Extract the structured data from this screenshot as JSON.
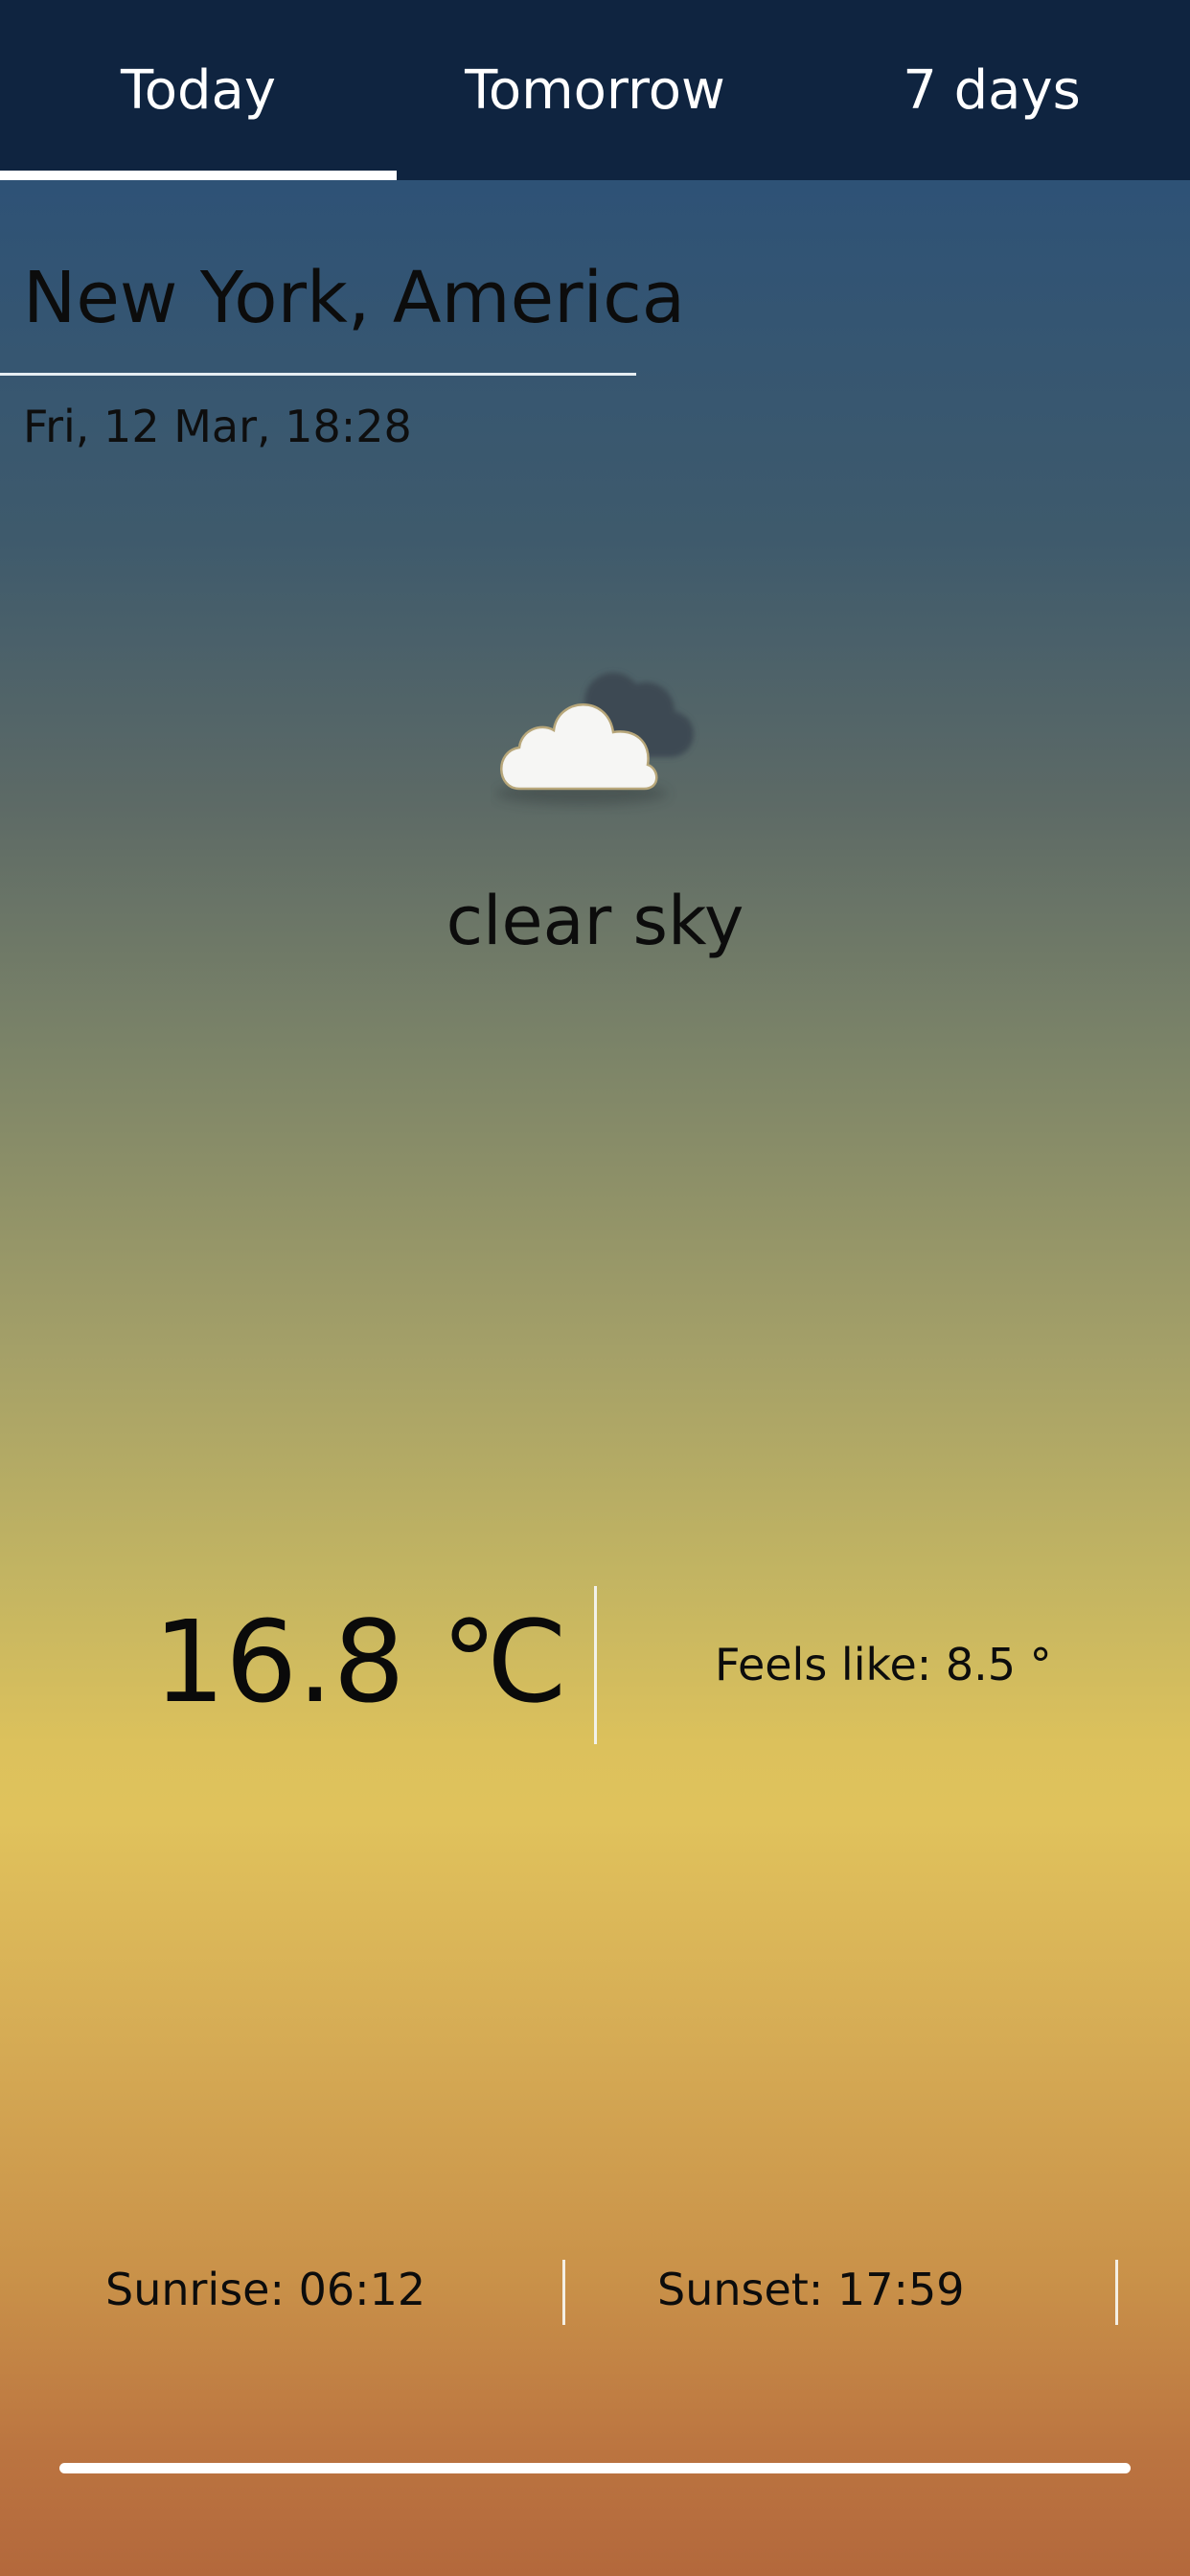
{
  "tabs": [
    {
      "label": "Today",
      "active": true
    },
    {
      "label": "Tomorrow",
      "active": false
    },
    {
      "label": "7 days",
      "active": false
    }
  ],
  "location": "New York, America",
  "datetime": "Fri, 12 Mar, 18:28",
  "weather": {
    "icon": "cloud-icon",
    "condition": "clear sky",
    "temperature": "16.8 ℃",
    "feels_like": "Feels like: 8.5 °"
  },
  "sun": {
    "sunrise": "Sunrise: 06:12",
    "sunset": "Sunset: 17:59"
  },
  "colors": {
    "tabbar": "#0f2440",
    "gradient_top": "#2b5078",
    "gradient_mid": "#e0c25c",
    "gradient_bottom": "#b3683c"
  }
}
